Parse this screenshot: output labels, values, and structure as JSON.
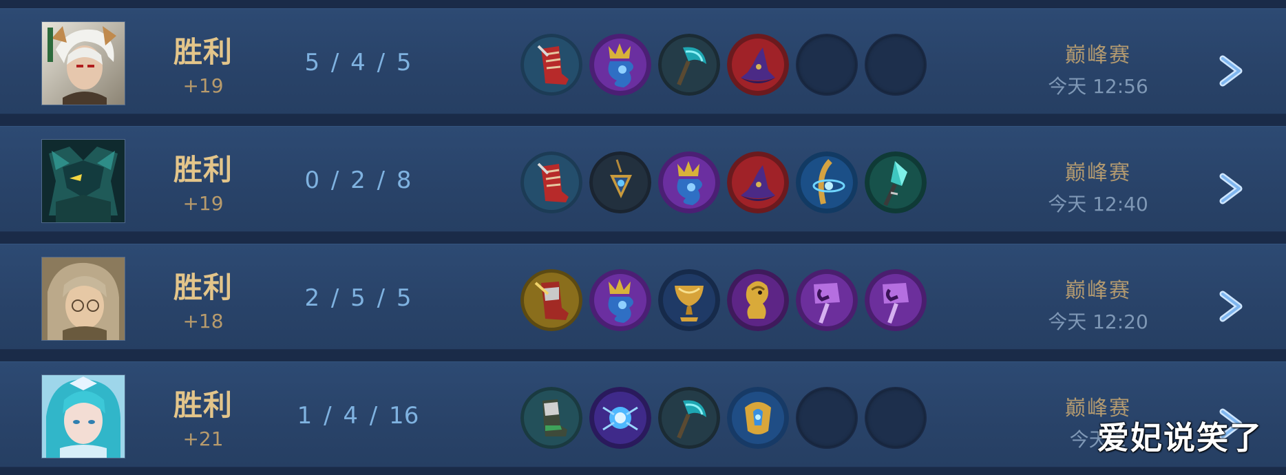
{
  "matches": [
    {
      "hero": "hero-portrait-silver-hair-warrior",
      "result": "胜利",
      "score": "+19",
      "kda": "5 / 4 / 5",
      "items": [
        "red-boots",
        "purple-dragon-orb",
        "teal-axe",
        "red-wizard-hat",
        "empty",
        "empty"
      ],
      "mode": "巅峰赛",
      "time": "今天 12:56"
    },
    {
      "hero": "hero-portrait-mech-armor",
      "result": "胜利",
      "score": "+19",
      "kda": "0 / 2 / 8",
      "items": [
        "red-boots",
        "gold-pendant",
        "purple-dragon-orb",
        "red-wizard-hat",
        "blue-orb-staff",
        "crystal-wand"
      ],
      "mode": "巅峰赛",
      "time": "今天 12:40"
    },
    {
      "hero": "hero-portrait-blonde-glasses",
      "result": "胜利",
      "score": "+18",
      "kda": "2 / 5 / 5",
      "items": [
        "gold-boots",
        "purple-dragon-orb",
        "gold-chalice",
        "gold-serpent",
        "purple-rune-scepter",
        "purple-rune-scepter"
      ],
      "mode": "巅峰赛",
      "time": "今天 12:20"
    },
    {
      "hero": "hero-portrait-teal-hair-mage",
      "result": "胜利",
      "score": "+21",
      "kda": "1 / 4 / 16",
      "items": [
        "green-boots",
        "blue-lightning-orb",
        "teal-axe",
        "gold-blue-relic",
        "empty",
        "empty"
      ],
      "mode": "巅峰赛",
      "time": "今天 1"
    }
  ],
  "watermark": "爱妃说笑了",
  "colors": {
    "result": "#e3c58a",
    "score": "#b89b6c",
    "kda": "#7fb2e0",
    "mode": "#b39a70",
    "time": "#7f98b6",
    "row_bg": "#294369"
  },
  "icons": {
    "chevron": "chevron-right-icon"
  }
}
